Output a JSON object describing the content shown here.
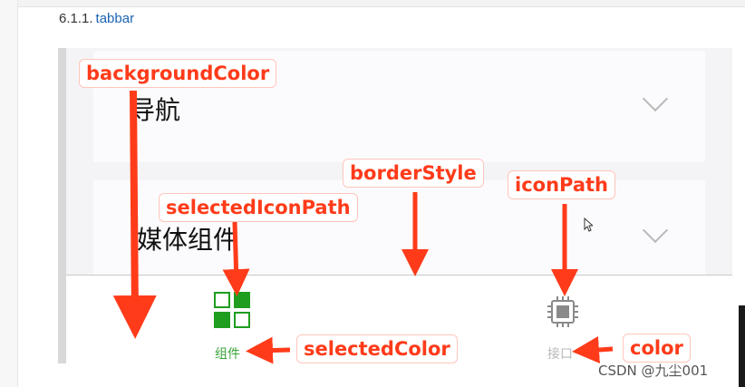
{
  "heading": {
    "number": "6.1.1.",
    "keyword": "tabbar"
  },
  "cards": [
    {
      "label": "导航"
    },
    {
      "label": "媒体组件"
    }
  ],
  "tabbar": {
    "tabs": [
      {
        "label": "组件",
        "icon": "grid-icon",
        "state": "selected"
      },
      {
        "label": "接口",
        "icon": "chip-icon",
        "state": "unselected"
      }
    ],
    "selected_color": "#1f9d1f",
    "unselected_color": "#b9b9b9"
  },
  "annotations": {
    "background_color": "backgroundColor",
    "border_style": "borderStyle",
    "icon_path": "iconPath",
    "selected_icon_path": "selectedIconPath",
    "selected_color": "selectedColor",
    "color": "color"
  },
  "annotation_color": "#ff3b1a",
  "watermark": "CSDN @九尘001"
}
